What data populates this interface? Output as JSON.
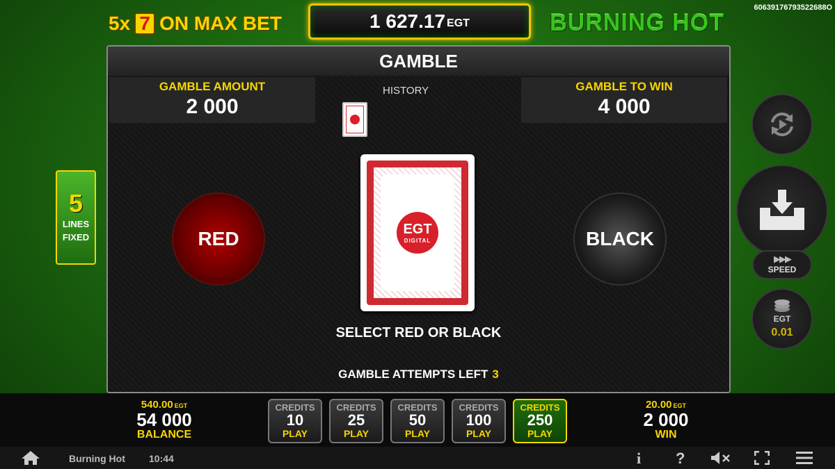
{
  "header": {
    "promo_prefix": "5x",
    "promo_symbol": "7",
    "promo_suffix": "ON MAX BET",
    "balance_value": "1 627.17",
    "balance_currency": "EGT",
    "game_title": "BURNING HOT",
    "session_id": "60639176793522688O"
  },
  "gamble": {
    "title": "GAMBLE",
    "amount_label": "GAMBLE AMOUNT",
    "amount_value": "2 000",
    "history_label": "HISTORY",
    "to_win_label": "GAMBLE TO WIN",
    "to_win_value": "4 000",
    "red_label": "RED",
    "black_label": "BLACK",
    "card_logo": "EGT",
    "card_logo_sub": "DIGITAL",
    "select_message": "SELECT RED OR BLACK",
    "attempts_label": "GAMBLE ATTEMPTS LEFT",
    "attempts_value": "3"
  },
  "lines": {
    "count": "5",
    "label_line1": "LINES",
    "label_line2": "FIXED"
  },
  "controls": {
    "speed_label": "SPEED",
    "denom_currency": "EGT",
    "denom_value": "0.01"
  },
  "bottom": {
    "balance_credits": "540.00",
    "balance_currency": "EGT",
    "balance_value": "54 000",
    "balance_label": "BALANCE",
    "win_credits": "20.00",
    "win_currency": "EGT",
    "win_value": "2 000",
    "win_label": "WIN",
    "bets": [
      {
        "credits_label": "CREDITS",
        "value": "10",
        "play_label": "PLAY"
      },
      {
        "credits_label": "CREDITS",
        "value": "25",
        "play_label": "PLAY"
      },
      {
        "credits_label": "CREDITS",
        "value": "50",
        "play_label": "PLAY"
      },
      {
        "credits_label": "CREDITS",
        "value": "100",
        "play_label": "PLAY"
      },
      {
        "credits_label": "CREDITS",
        "value": "250",
        "play_label": "PLAY"
      }
    ],
    "active_bet": "250"
  },
  "footer": {
    "title": "Burning Hot",
    "time": "10:44",
    "info_glyph": "i",
    "help_glyph": "?"
  },
  "colors": {
    "accent": "#f7d600",
    "brand_green": "#38c41d",
    "red": "#b00000"
  }
}
